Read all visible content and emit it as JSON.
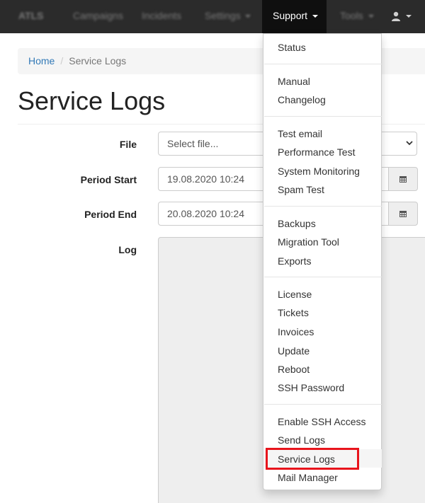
{
  "navbar": {
    "brand": "ATLS",
    "items": [
      "Campaigns",
      "Incidents",
      "Settings",
      "Tools"
    ],
    "support_label": "Support"
  },
  "breadcrumb": {
    "home": "Home",
    "separator": "/",
    "current": "Service Logs"
  },
  "page_title": "Service Logs",
  "form": {
    "file_label": "File",
    "file_placeholder": "Select file...",
    "period_start_label": "Period Start",
    "period_start_value": "19.08.2020 10:24",
    "period_end_label": "Period End",
    "period_end_value": "20.08.2020 10:24",
    "log_label": "Log"
  },
  "dropdown": {
    "status": "Status",
    "manual": "Manual",
    "changelog": "Changelog",
    "test_email": "Test email",
    "performance_test": "Performance Test",
    "system_monitoring": "System Monitoring",
    "spam_test": "Spam Test",
    "backups": "Backups",
    "migration_tool": "Migration Tool",
    "exports": "Exports",
    "license": "License",
    "tickets": "Tickets",
    "invoices": "Invoices",
    "update": "Update",
    "reboot": "Reboot",
    "ssh_password": "SSH Password",
    "enable_ssh_access": "Enable SSH Access",
    "send_logs": "Send Logs",
    "service_logs": "Service Logs",
    "mail_manager": "Mail Manager"
  },
  "colors": {
    "highlight": "#e8141c",
    "link": "#337ab7",
    "navbar": "#2b2b2b"
  }
}
